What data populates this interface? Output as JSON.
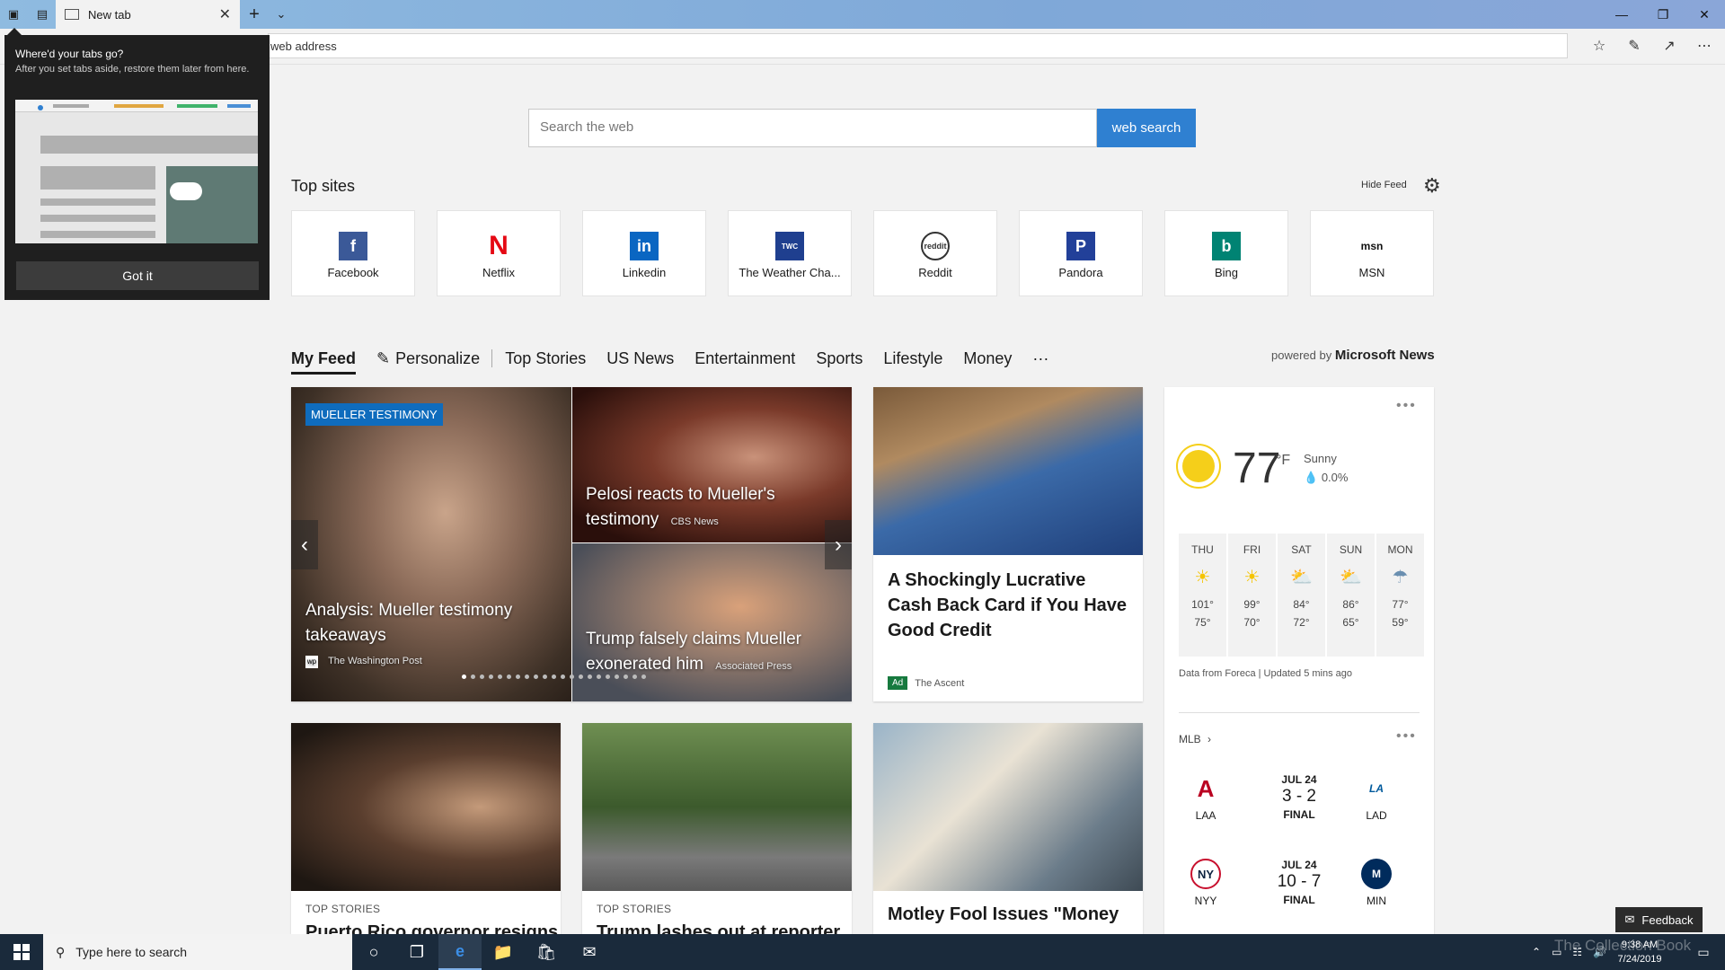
{
  "browser": {
    "tab_title": "New tab",
    "address_placeholder": "web address"
  },
  "search": {
    "placeholder": "Search the web",
    "button_label": "web search"
  },
  "top_sites": {
    "title": "Top sites",
    "hide_feed": "Hide Feed",
    "sites": [
      {
        "label": "Facebook",
        "logo": "f",
        "color": "#3b5998"
      },
      {
        "label": "Netflix",
        "logo": "N",
        "color": "#e50914"
      },
      {
        "label": "Linkedin",
        "logo": "in",
        "color": "#0a66c2"
      },
      {
        "label": "The Weather Cha...",
        "logo": "TWC",
        "color": "#1f3f8f"
      },
      {
        "label": "Reddit",
        "logo": "reddit",
        "color": "#ff4500"
      },
      {
        "label": "Pandora",
        "logo": "P",
        "color": "#224099"
      },
      {
        "label": "Bing",
        "logo": "b",
        "color": "#008373"
      },
      {
        "label": "MSN",
        "logo": "msn",
        "color": "#111111"
      }
    ]
  },
  "feed_nav": {
    "items": [
      "My Feed",
      "Personalize",
      "Top Stories",
      "US News",
      "Entertainment",
      "Sports",
      "Lifestyle",
      "Money",
      "···"
    ],
    "powered_prefix": "powered by",
    "powered_brand": "Microsoft News"
  },
  "carousel": {
    "badge": "MUELLER TESTIMONY",
    "main_title": "Analysis: Mueller testimony takeaways",
    "main_source": "The Washington Post",
    "story2_title": "Pelosi reacts to Mueller's testimony",
    "story2_source": "CBS News",
    "story3_title": "Trump falsely claims Mueller exonerated him",
    "story3_source": "Associated Press"
  },
  "ad_card": {
    "title": "A Shockingly Lucrative Cash Back Card if You Have Good Credit",
    "ad_label": "Ad",
    "advertiser": "The Ascent"
  },
  "stories": [
    {
      "category": "TOP STORIES",
      "title": "Puerto Rico governor resigns"
    },
    {
      "category": "TOP STORIES",
      "title": "Trump lashes out at reporter"
    },
    {
      "category": "",
      "title": "Motley Fool Issues \"Money"
    }
  ],
  "weather": {
    "temp": "77",
    "unit": "°F",
    "condition": "Sunny",
    "precip": "0.0%",
    "forecast": [
      {
        "day": "THU",
        "icon": "sun-icon",
        "high": "101°",
        "low": "75°"
      },
      {
        "day": "FRI",
        "icon": "sun-icon",
        "high": "99°",
        "low": "70°"
      },
      {
        "day": "SAT",
        "icon": "partly-cloudy-icon",
        "high": "84°",
        "low": "72°"
      },
      {
        "day": "SUN",
        "icon": "partly-cloudy-icon",
        "high": "86°",
        "low": "65°"
      },
      {
        "day": "MON",
        "icon": "rain-icon",
        "high": "77°",
        "low": "59°"
      }
    ],
    "footer": "Data from Foreca | Updated 5 mins ago"
  },
  "mlb": {
    "label": "MLB",
    "games": [
      {
        "away": "LAA",
        "home": "LAD",
        "date": "JUL 24",
        "score": "3 - 2",
        "status": "FINAL",
        "away_color": "#ba0021",
        "home_color": "#005a9c"
      },
      {
        "away": "NYY",
        "home": "MIN",
        "date": "JUL 24",
        "score": "10 - 7",
        "status": "FINAL",
        "away_color": "#c4ced3",
        "home_color": "#002b5c"
      }
    ]
  },
  "popup": {
    "title": "Where'd your tabs go?",
    "body": "After you set tabs aside, restore them later from here.",
    "button": "Got it"
  },
  "feedback": "Feedback",
  "taskbar": {
    "search_placeholder": "Type here to search",
    "time": "9:38 AM",
    "date": "7/24/2019",
    "watermark": "The Collection Book"
  }
}
